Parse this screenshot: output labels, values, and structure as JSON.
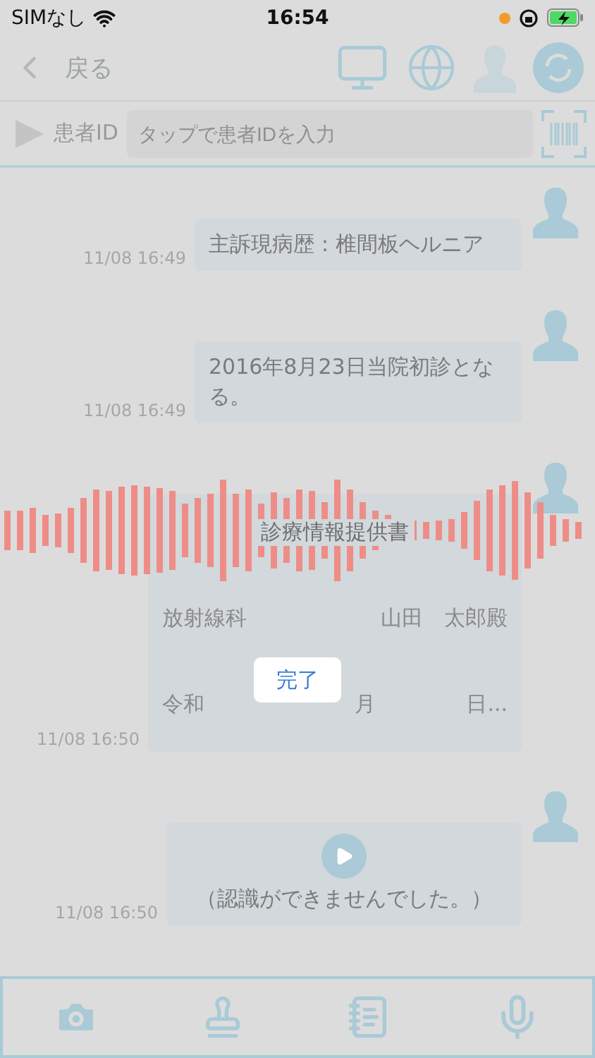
{
  "status_bar": {
    "carrier": "SIMなし",
    "time": "16:54"
  },
  "nav": {
    "back": "戻る"
  },
  "patient": {
    "label": "患者ID",
    "placeholder": "タップで患者IDを入力"
  },
  "messages": [
    {
      "kind": "text",
      "text": "主訴現病歴：椎間板ヘルニア",
      "time": "11/08 16:49"
    },
    {
      "kind": "text",
      "text": "2016年8月23日当院初診となる。",
      "time": "11/08 16:49"
    },
    {
      "kind": "document",
      "title": "診療情報提供書",
      "recipient": {
        "department": "放射線科",
        "name": "山田　太郎殿"
      },
      "date": {
        "era": "令和",
        "month": "月",
        "day": "日..."
      },
      "time": "11/08 16:50"
    },
    {
      "kind": "audio",
      "text": "（認識ができませんでした。）",
      "time": "11/08 16:50"
    }
  ],
  "done_button": "完了"
}
